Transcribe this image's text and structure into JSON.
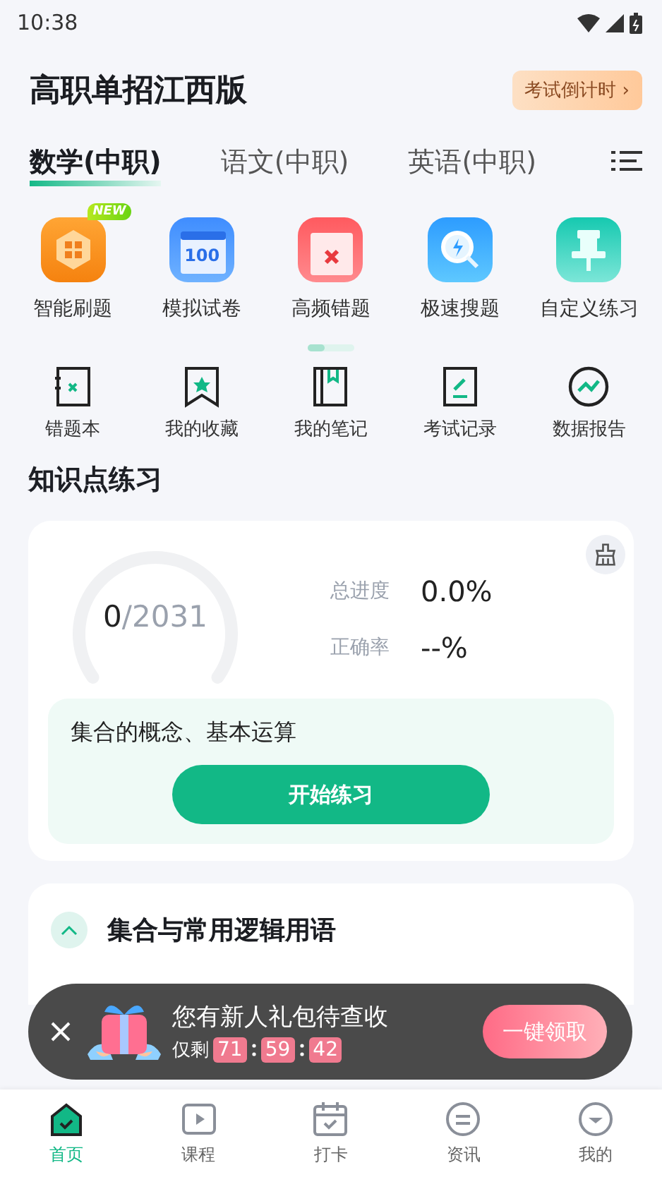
{
  "status_bar": {
    "time": "10:38"
  },
  "header": {
    "title": "高职单招江西版",
    "countdown_button": "考试倒计时 ›"
  },
  "subject_tabs": [
    {
      "label": "数学(中职)",
      "selected": true
    },
    {
      "label": "语文(中职)",
      "selected": false
    },
    {
      "label": "英语(中职)",
      "selected": false
    }
  ],
  "feature_grid": [
    {
      "label": "智能刷题",
      "badge": "NEW"
    },
    {
      "label": "模拟试卷",
      "number": "100"
    },
    {
      "label": "高频错题"
    },
    {
      "label": "极速搜题"
    },
    {
      "label": "自定义练习"
    }
  ],
  "tool_row": [
    {
      "label": "错题本"
    },
    {
      "label": "我的收藏"
    },
    {
      "label": "我的笔记"
    },
    {
      "label": "考试记录"
    },
    {
      "label": "数据报告"
    }
  ],
  "section_title": "知识点练习",
  "progress_card": {
    "done": "0",
    "total": "/2031",
    "stats": [
      {
        "label": "总进度",
        "value": "0.0%"
      },
      {
        "label": "正确率",
        "value": "--%"
      }
    ],
    "current_topic": "集合的概念、基本运算",
    "start_button": "开始练习"
  },
  "chapter": {
    "title": "集合与常用逻辑用语",
    "expanded": true
  },
  "gift_banner": {
    "title": "您有新人礼包待查收",
    "remaining_label": "仅剩",
    "timer": [
      "71",
      "59",
      "42"
    ],
    "claim_button": "一键领取"
  },
  "bottom_nav": [
    {
      "label": "首页",
      "selected": true
    },
    {
      "label": "课程",
      "selected": false
    },
    {
      "label": "打卡",
      "selected": false
    },
    {
      "label": "资讯",
      "selected": false
    },
    {
      "label": "我的",
      "selected": false
    }
  ]
}
